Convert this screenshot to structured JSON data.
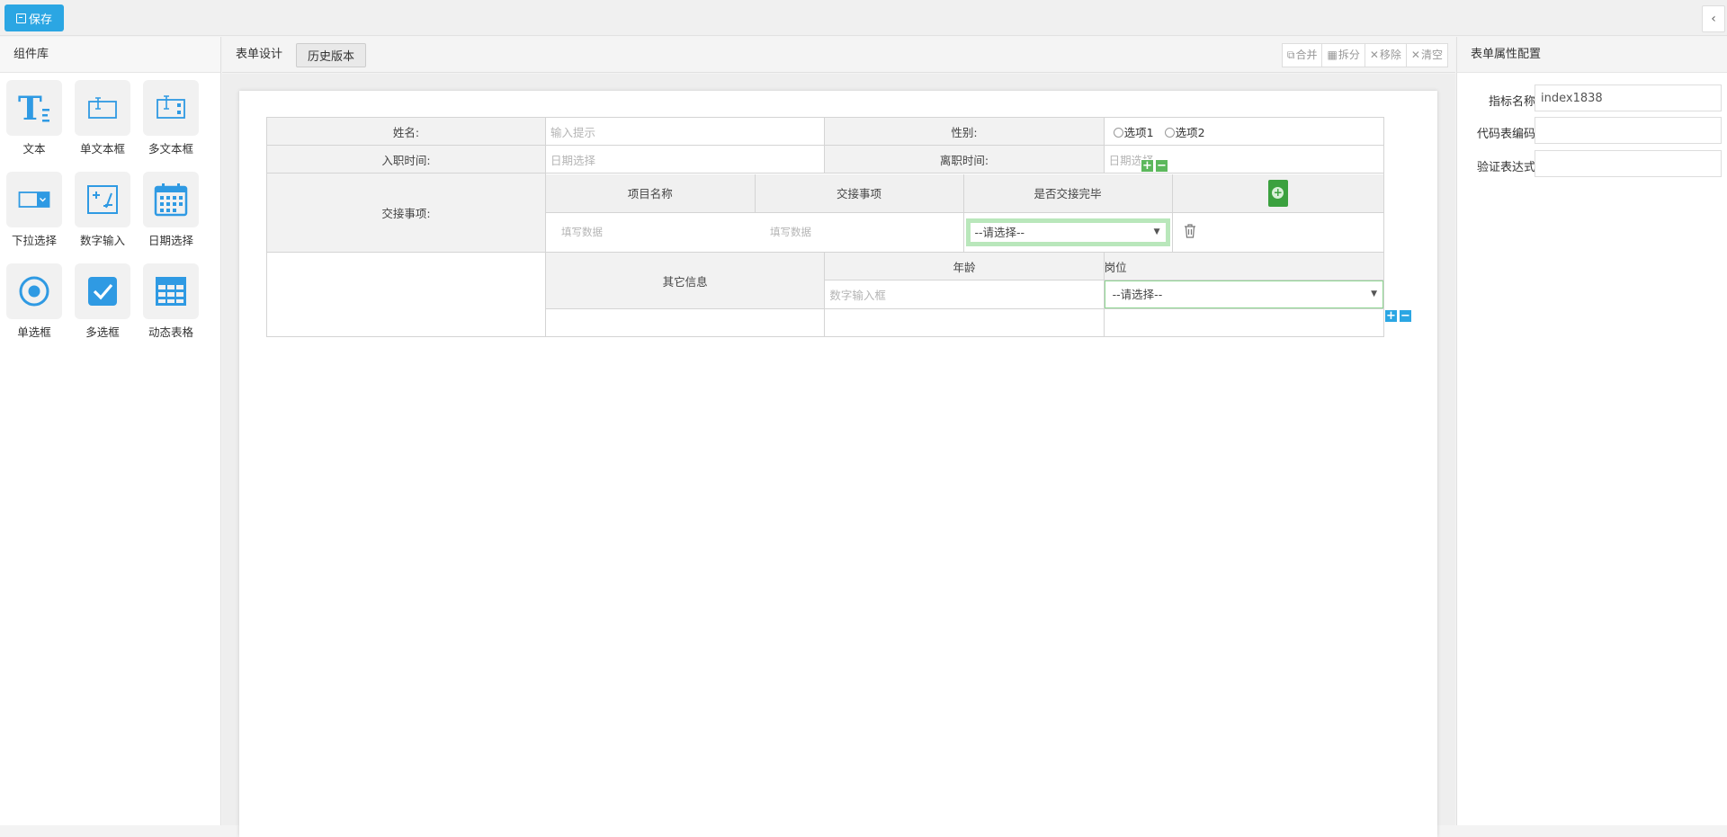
{
  "toolbar": {
    "save_label": "保存",
    "collapse_icon": "chevron-left-icon"
  },
  "left_panel": {
    "title": "组件库",
    "components": [
      {
        "label": "文本",
        "icon": "text-icon"
      },
      {
        "label": "单文本框",
        "icon": "single-textbox-icon"
      },
      {
        "label": "多文本框",
        "icon": "multi-textbox-icon"
      },
      {
        "label": "下拉选择",
        "icon": "dropdown-icon"
      },
      {
        "label": "数字输入",
        "icon": "number-input-icon"
      },
      {
        "label": "日期选择",
        "icon": "calendar-icon"
      },
      {
        "label": "单选框",
        "icon": "radio-icon"
      },
      {
        "label": "多选框",
        "icon": "checkbox-icon"
      },
      {
        "label": "动态表格",
        "icon": "table-icon"
      }
    ]
  },
  "center": {
    "title": "表单设计",
    "history_button": "历史版本",
    "tools": [
      {
        "label": "合并",
        "icon": "merge-icon"
      },
      {
        "label": "拆分",
        "icon": "split-icon"
      },
      {
        "label": "移除",
        "icon": "close-icon"
      },
      {
        "label": "清空",
        "icon": "close-icon"
      }
    ]
  },
  "form": {
    "row1": {
      "name_label": "姓名:",
      "name_placeholder": "输入提示",
      "gender_label": "性别:",
      "options": [
        "选项1",
        "选项2"
      ]
    },
    "row2": {
      "entry_label": "入职时间:",
      "entry_placeholder": "日期选择",
      "leave_label": "离职时间:",
      "leave_placeholder": "日期选择"
    },
    "handover": {
      "label": "交接事项:",
      "headers": [
        "项目名称",
        "交接事项",
        "是否交接完毕"
      ],
      "row": {
        "cell1": "填写数据",
        "cell2": "填写数据",
        "select": "--请选择--"
      }
    },
    "other": {
      "label": "其它信息",
      "age_header": "年龄",
      "post_header": "岗位",
      "age_placeholder": "数字输入框",
      "post_select": "--请选择--"
    }
  },
  "right_panel": {
    "title": "表单属性配置",
    "fields": [
      {
        "label": "指标名称",
        "value": "index1838"
      },
      {
        "label": "代码表编码",
        "value": ""
      },
      {
        "label": "验证表达式",
        "value": ""
      }
    ]
  }
}
